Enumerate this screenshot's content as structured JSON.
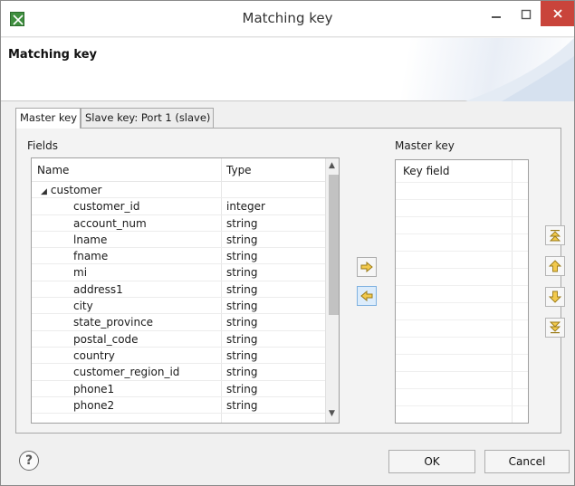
{
  "window": {
    "title": "Matching key"
  },
  "header": {
    "title": "Matching key"
  },
  "tabs": [
    {
      "label": "Master key",
      "active": true
    },
    {
      "label": "Slave key: Port 1 (slave)",
      "active": false
    }
  ],
  "fields": {
    "section_label": "Fields",
    "columns": {
      "name": "Name",
      "type": "Type"
    },
    "parent": "customer",
    "rows": [
      {
        "name": "customer_id",
        "type": "integer"
      },
      {
        "name": "account_num",
        "type": "string"
      },
      {
        "name": "lname",
        "type": "string"
      },
      {
        "name": "fname",
        "type": "string"
      },
      {
        "name": "mi",
        "type": "string"
      },
      {
        "name": "address1",
        "type": "string"
      },
      {
        "name": "city",
        "type": "string"
      },
      {
        "name": "state_province",
        "type": "string"
      },
      {
        "name": "postal_code",
        "type": "string"
      },
      {
        "name": "country",
        "type": "string"
      },
      {
        "name": "customer_region_id",
        "type": "string"
      },
      {
        "name": "phone1",
        "type": "string"
      },
      {
        "name": "phone2",
        "type": "string"
      }
    ]
  },
  "master_key": {
    "section_label": "Master key",
    "column": "Key field"
  },
  "footer": {
    "ok_label": "OK",
    "cancel_label": "Cancel",
    "help_glyph": "?"
  },
  "colors": {
    "close_button": "#c9443b",
    "arrow_fill": "#f2c94c",
    "selected_button": "#dcecfb"
  }
}
